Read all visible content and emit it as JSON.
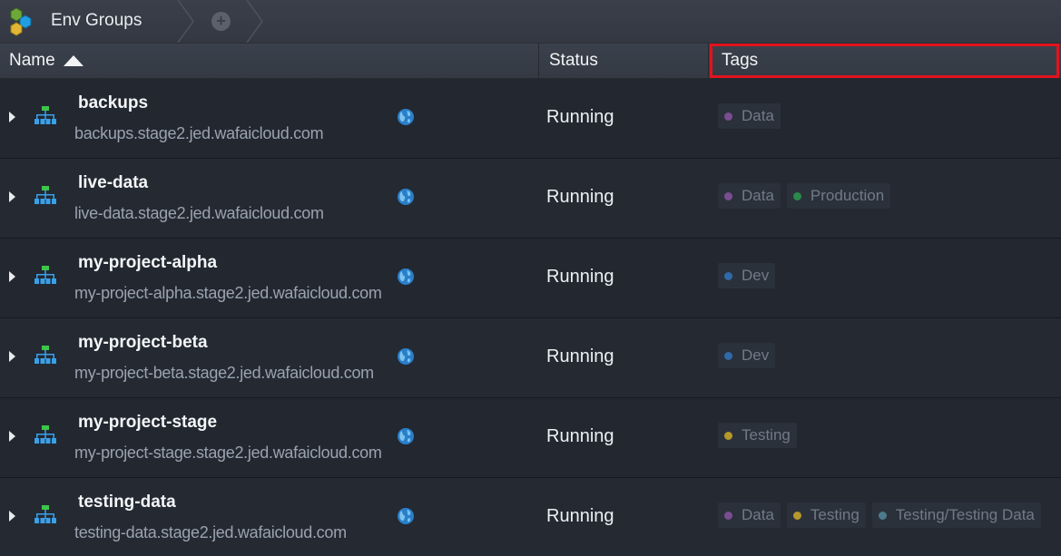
{
  "tabbar": {
    "active_tab_label": "Env Groups",
    "add_tab_icon": "plus-circle-icon"
  },
  "columns": {
    "name": "Name",
    "status": "Status",
    "tags": "Tags",
    "sort": "ascending"
  },
  "colors": {
    "tag_data": "#7a4d92",
    "tag_production": "#2a8a4a",
    "tag_dev": "#2e6aa8",
    "tag_testing": "#b5972a",
    "tag_testing_data": "#4d7a8c",
    "highlight": "#e0141e"
  },
  "rows": [
    {
      "name": "backups",
      "domain": "backups.stage2.jed.wafaicloud.com",
      "status": "Running",
      "tags": [
        {
          "label": "Data",
          "color": "#7a4d92"
        }
      ]
    },
    {
      "name": "live-data",
      "domain": "live-data.stage2.jed.wafaicloud.com",
      "status": "Running",
      "tags": [
        {
          "label": "Data",
          "color": "#7a4d92"
        },
        {
          "label": "Production",
          "color": "#2a8a4a"
        }
      ]
    },
    {
      "name": "my-project-alpha",
      "domain": "my-project-alpha.stage2.jed.wafaicloud.com",
      "status": "Running",
      "tags": [
        {
          "label": "Dev",
          "color": "#2e6aa8"
        }
      ]
    },
    {
      "name": "my-project-beta",
      "domain": "my-project-beta.stage2.jed.wafaicloud.com",
      "status": "Running",
      "tags": [
        {
          "label": "Dev",
          "color": "#2e6aa8"
        }
      ]
    },
    {
      "name": "my-project-stage",
      "domain": "my-project-stage.stage2.jed.wafaicloud.com",
      "status": "Running",
      "tags": [
        {
          "label": "Testing",
          "color": "#b5972a"
        }
      ]
    },
    {
      "name": "testing-data",
      "domain": "testing-data.stage2.jed.wafaicloud.com",
      "status": "Running",
      "tags": [
        {
          "label": "Data",
          "color": "#7a4d92"
        },
        {
          "label": "Testing",
          "color": "#b5972a"
        },
        {
          "label": "Testing/Testing Data",
          "color": "#4d7a8c"
        }
      ]
    }
  ]
}
